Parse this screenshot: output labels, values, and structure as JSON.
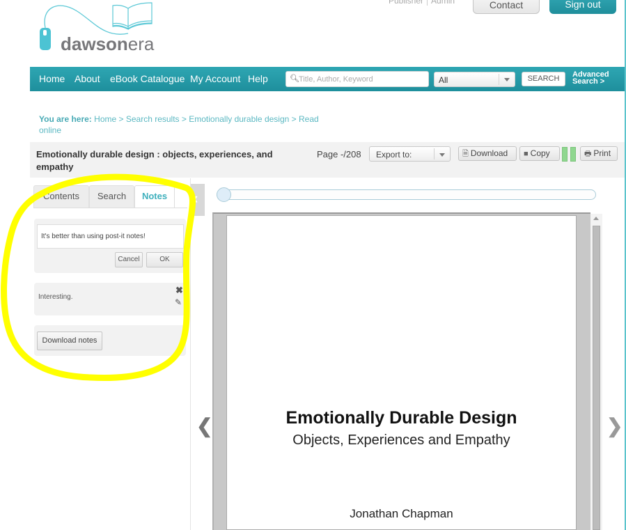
{
  "brand": {
    "logo_text_main": "dawson",
    "logo_text_accent": "era",
    "accent_color": "#2ea6b3",
    "logo_color": "#5bc8d6"
  },
  "top_links": {
    "publisher": "Publisher",
    "admin": "Admin",
    "contact": "Contact",
    "sign_out": "Sign out"
  },
  "nav": {
    "items": [
      {
        "label": "Home"
      },
      {
        "label": "About"
      },
      {
        "label": "eBook Catalogue"
      },
      {
        "label": "My Account"
      },
      {
        "label": "Help"
      }
    ],
    "search": {
      "placeholder": "Title, Author, Keyword",
      "value": "",
      "icon": "search-icon"
    },
    "scope_select": {
      "value": "All"
    },
    "search_button": "SEARCH",
    "advanced_search_line1": "Advanced",
    "advanced_search_line2": "Search >"
  },
  "breadcrumb": {
    "label": "You are here:",
    "path": "Home > Search results > Emotionally durable design > Read online"
  },
  "book": {
    "title": "Emotionally durable design : objects, experiences, and empathy",
    "page_indicator": "Page -/208",
    "total_pages": 208
  },
  "toolbar": {
    "export_select": "Export to:",
    "download": "Download",
    "copy": "Copy",
    "print": "Print",
    "download_icon": "file-download-icon",
    "copy_icon": "document-icon",
    "print_icon": "printer-icon"
  },
  "side_panel": {
    "tabs": [
      {
        "label": "Contents",
        "active": false
      },
      {
        "label": "Search",
        "active": false
      },
      {
        "label": "Notes",
        "active": true
      }
    ],
    "note_editor": {
      "value": "It's better than using post-it notes!",
      "cancel": "Cancel",
      "ok": "OK"
    },
    "notes": [
      {
        "text": "Interesting."
      }
    ],
    "download_notes": "Download notes"
  },
  "viewer": {
    "slider_position": 0,
    "page_title": "Emotionally Durable Design",
    "page_subtitle": "Objects, Experiences and Empathy",
    "page_author": "Jonathan Chapman",
    "prev": "❮",
    "next": "❯"
  }
}
